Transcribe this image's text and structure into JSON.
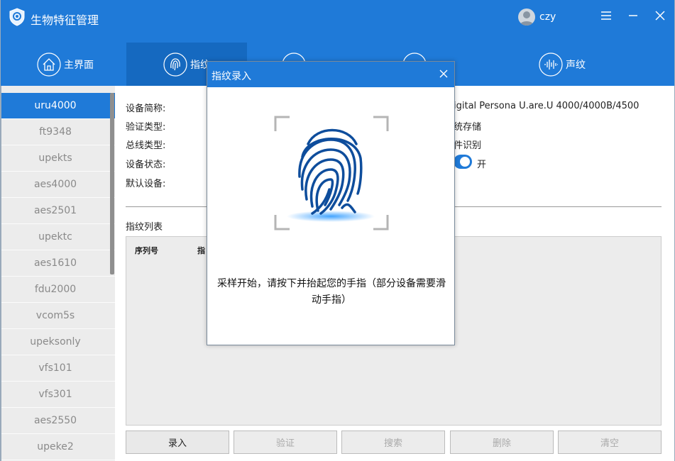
{
  "app": {
    "title": "生物特征管理",
    "user": "czy",
    "accent": "#1f7ad8"
  },
  "tabs": [
    {
      "label": "主界面",
      "icon": "home-icon"
    },
    {
      "label": "指纹",
      "icon": "fingerprint-icon"
    },
    {
      "label": "",
      "icon": "face-icon"
    },
    {
      "label": "",
      "icon": "iris-icon"
    },
    {
      "label": "声纹",
      "icon": "voiceprint-icon"
    }
  ],
  "devices": [
    "uru4000",
    "ft9348",
    "upekts",
    "aes4000",
    "aes2501",
    "upektc",
    "aes1610",
    "fdu2000",
    "vcom5s",
    "upeksonly",
    "vfs101",
    "vfs301",
    "aes2550",
    "upeke2"
  ],
  "info": {
    "labels": [
      "设备简称:",
      "验证类型:",
      "总线类型:",
      "设备状态:",
      "默认设备:"
    ],
    "device_name_value": "igital Persona U.are.U 4000/4000B/4500",
    "verify_type_value": "统存储",
    "bus_type_value": "件识别",
    "status_label": "开"
  },
  "fingerprint_list": {
    "title": "指纹列表",
    "col_seq": "序列号",
    "col_name": "指"
  },
  "buttons": {
    "enroll": "录入",
    "verify": "验证",
    "search": "搜索",
    "delete": "删除",
    "clear": "清空"
  },
  "dialog": {
    "title": "指纹录入",
    "message": "采样开始，请按下并抬起您的手指（部分设备需要滑动手指）"
  }
}
